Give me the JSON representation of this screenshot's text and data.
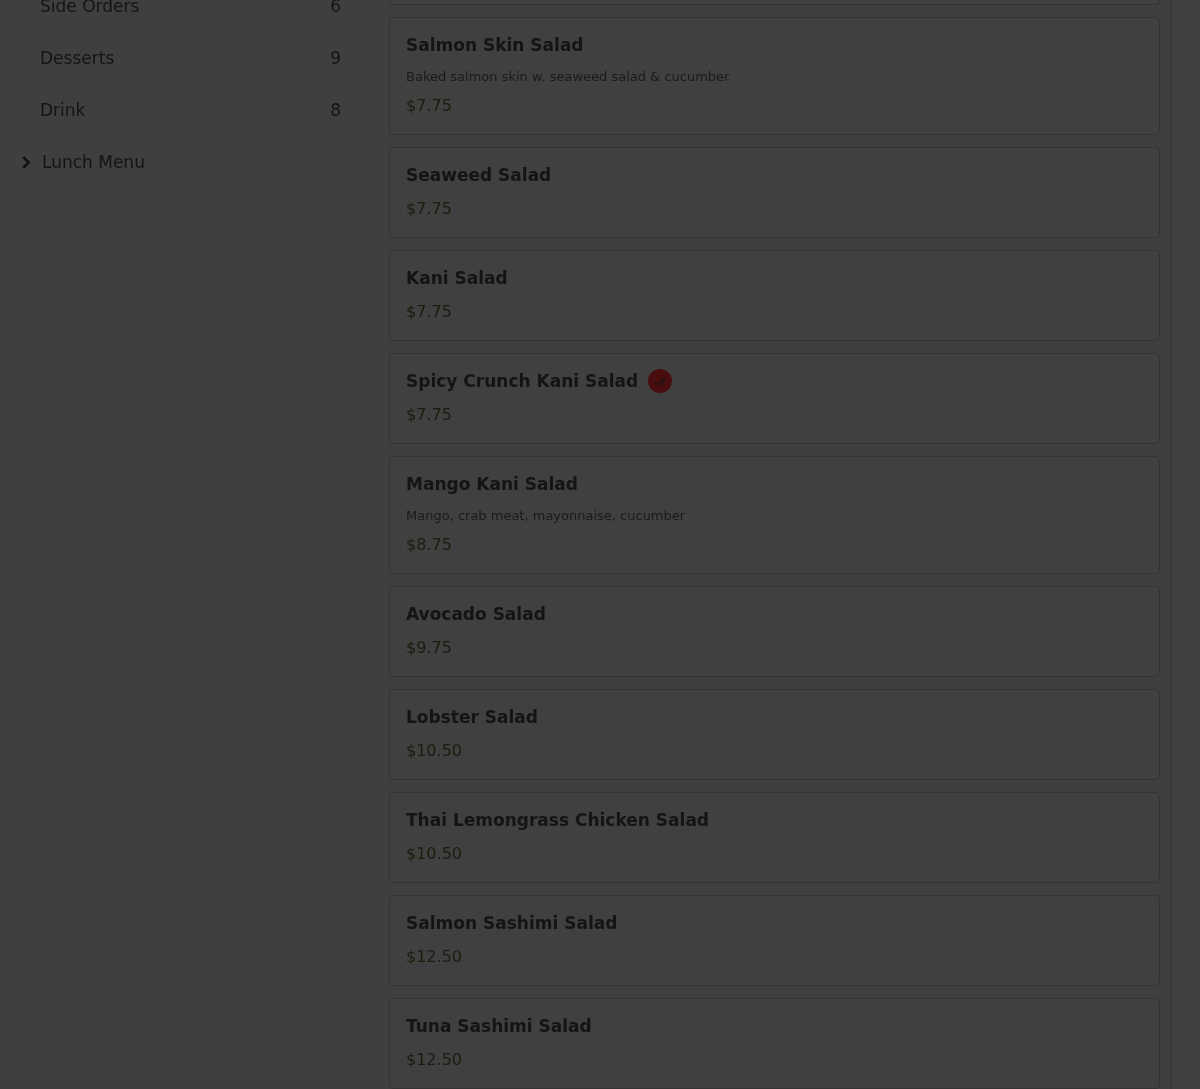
{
  "sidebar": {
    "categories": [
      {
        "name": "Side Orders",
        "count": "6"
      },
      {
        "name": "Desserts",
        "count": "9"
      },
      {
        "name": "Drink",
        "count": "8"
      }
    ],
    "sections": [
      {
        "label": "Lunch Menu",
        "expanded": false
      }
    ]
  },
  "menu_items": [
    {
      "name": "Salmon Skin Salad",
      "description": "Baked salmon skin w. seaweed salad & cucumber",
      "price": "$7.75",
      "spicy": false
    },
    {
      "name": "Seaweed Salad",
      "price": "$7.75",
      "spicy": false
    },
    {
      "name": "Kani Salad",
      "price": "$7.75",
      "spicy": false
    },
    {
      "name": "Spicy Crunch Kani Salad",
      "price": "$7.75",
      "spicy": true
    },
    {
      "name": "Mango Kani Salad",
      "description": "Mango, crab meat, mayonnaise, cucumber",
      "price": "$8.75",
      "spicy": false
    },
    {
      "name": "Avocado Salad",
      "price": "$9.75",
      "spicy": false
    },
    {
      "name": "Lobster Salad",
      "price": "$10.50",
      "spicy": false
    },
    {
      "name": "Thai Lemongrass Chicken Salad",
      "price": "$10.50",
      "spicy": false
    },
    {
      "name": "Salmon Sashimi Salad",
      "price": "$12.50",
      "spicy": false
    },
    {
      "name": "Tuna Sashimi Salad",
      "price": "$12.50",
      "spicy": false
    }
  ]
}
